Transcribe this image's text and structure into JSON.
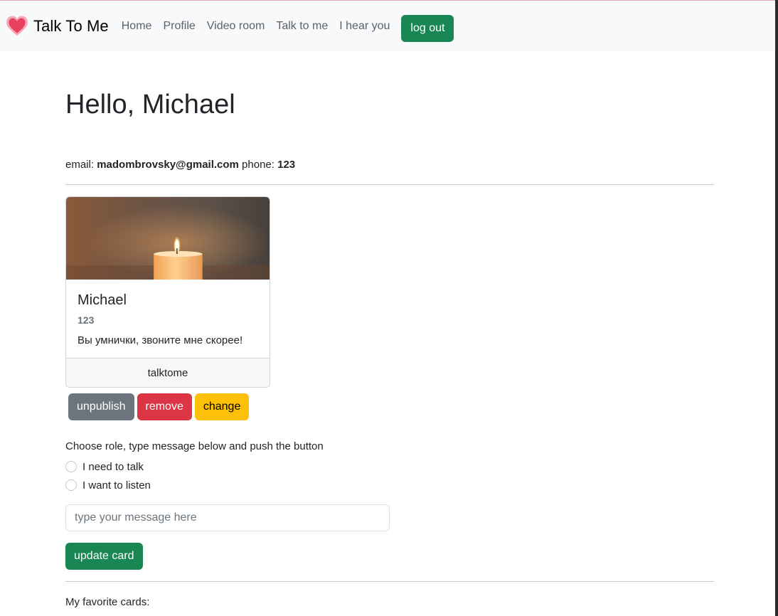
{
  "nav": {
    "brand": "Talk To Me",
    "links": [
      "Home",
      "Profile",
      "Video room",
      "Talk to me",
      "I hear you"
    ],
    "logout": "log out",
    "colors": {
      "heart": "#e8405f",
      "heart_glow": "#f7a6b6"
    }
  },
  "page": {
    "title": "Hello, Michael",
    "email_label": "email:",
    "email": "madombrovsky@gmail.com",
    "phone_label": "phone:",
    "phone": "123"
  },
  "card": {
    "name": "Michael",
    "phone": "123",
    "message": "Вы умнички, звоните мне скорее!",
    "footer": "talktome"
  },
  "actions": {
    "unpublish": "unpublish",
    "remove": "remove",
    "change": "change"
  },
  "form": {
    "instructions": "Choose role, type message below and push the button",
    "roles": [
      "I need to talk",
      "I want to listen"
    ],
    "placeholder": "type your message here",
    "submit": "update card"
  },
  "favorites_label": "My favorite cards:"
}
